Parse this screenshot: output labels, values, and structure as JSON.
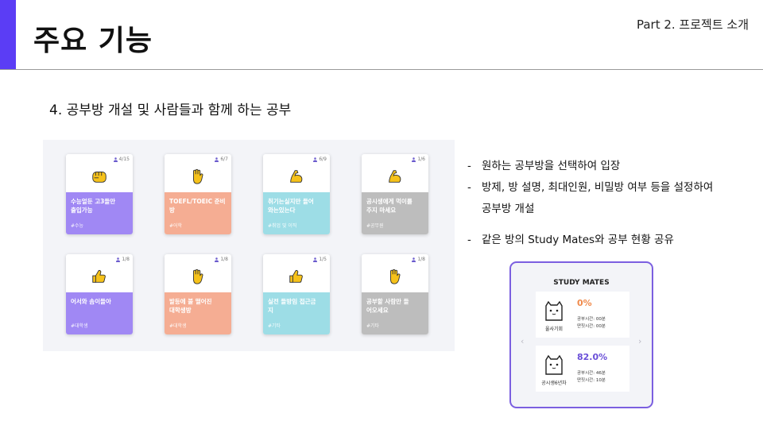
{
  "header": {
    "title": "주요 기능",
    "part_label": "Part 2. 프로젝트 소개"
  },
  "section": {
    "heading": "4. 공부방 개설 및 사람들과 함께 하는 공부"
  },
  "rooms": [
    {
      "count": "4/15",
      "emoji": "fist-icon",
      "name": "수능얼둔 고3들만\n출입가능",
      "tag": "#수능",
      "color": "#a088f4"
    },
    {
      "count": "6/7",
      "emoji": "hand-icon",
      "name": "TOEFL/TOEIC 준비\n방",
      "tag": "#어학",
      "color": "#f5ad93"
    },
    {
      "count": "6/9",
      "emoji": "muscle-icon",
      "name": "취기는실지만 들어\n와는있는다",
      "tag": "#취업 및 이직",
      "color": "#9ddde6"
    },
    {
      "count": "1/6",
      "emoji": "muscle-icon",
      "name": "공시생에게 먹이를\n주지 마세요",
      "tag": "#공무원",
      "color": "#bdbdbd"
    },
    {
      "count": "1/8",
      "emoji": "thumbs-up-icon",
      "name": "어서와 솜이들아",
      "tag": "#대학생",
      "color": "#a088f4"
    },
    {
      "count": "1/8",
      "emoji": "hand-icon",
      "name": "발등에 불 떨어진\n대학생방",
      "tag": "#대학생",
      "color": "#f5ad93"
    },
    {
      "count": "1/5",
      "emoji": "thumbs-up-icon",
      "name": "실전 들방임 접근금\n지",
      "tag": "#기타",
      "color": "#9ddde6"
    },
    {
      "count": "1/8",
      "emoji": "hand-icon",
      "name": "공부할 사람만 들\n어오세요",
      "tag": "#기타",
      "color": "#bdbdbd"
    }
  ],
  "bullets": {
    "b1": "원하는 공부방을 선택하여 입장",
    "b2": "방제, 방 설명, 최대인원, 비밀방 여부 등을 설정하여",
    "b2_cont": "공부방 개설",
    "b3": "같은 방의 Study Mates와 공부 현황 공유"
  },
  "study_mates": {
    "title": "STUDY MATES",
    "mates": [
      {
        "name": "울사기회",
        "percent": "0%",
        "study_time": "공부시간: 00분",
        "other_time": "딴짓시간: 00분",
        "color": "#f08a4b"
      },
      {
        "name": "공시생6년차",
        "percent": "82.0%",
        "study_time": "공부시간: 46분",
        "other_time": "딴짓시간: 10분",
        "color": "#6a4fd8"
      }
    ]
  },
  "colors": {
    "accent": "#5b3df5",
    "phone_border": "#7b5fe0",
    "emoji_yellow": "#f6c21a"
  }
}
